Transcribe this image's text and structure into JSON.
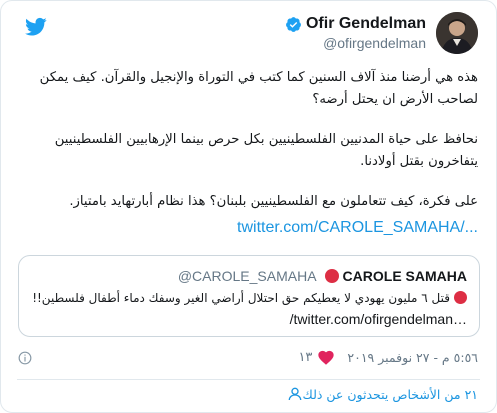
{
  "author": {
    "name": "Ofir Gendelman",
    "handle": "@ofirgendelman"
  },
  "tweet": {
    "paragraphs": [
      "هذه هي أرضنا منذ آلاف السنين كما كتب في التوراة والإنجيل والقرآن. كيف يمكن لصاحب الأرض ان يحتل أرضه؟",
      "نحافظ على حياة المدنيين الفلسطينيين بكل حرص بينما الإرهابيين الفلسطينيين يتفاخرون بقتل أولادنا.",
      "على فكرة، كيف تتعاملون مع الفلسطينيين بلبنان؟ هذا نظام أبارتهايد بامتياز."
    ],
    "link_text": "twitter.com/CAROLE_SAMAHA/..."
  },
  "quoted": {
    "name": "CAROLE SAMAHA",
    "handle": "@CAROLE_SAMAHA",
    "text": "قتل ٦ مليون يهودي لا يعطيكم حق احتلال أراضي الغير وسفك دماء أطفال فلسطين!!",
    "link_text": "/twitter.com/ofirgendelman…"
  },
  "meta": {
    "timestamp": "٥:٥٦ م - ٢٧ نوفمبر ٢٠١٩",
    "likes": "١٣"
  },
  "footer": {
    "text": "٢١ من الأشخاص يتحدثون عن ذلك"
  },
  "colors": {
    "link": "#1b95e0",
    "heart": "#e0245e",
    "verified": "#1da1f2",
    "quote_dot": "#dd2e44"
  },
  "icons": [
    "twitter-bird-icon",
    "verified-badge-icon",
    "heart-icon",
    "info-icon",
    "person-icon",
    "red-circle-icon"
  ]
}
